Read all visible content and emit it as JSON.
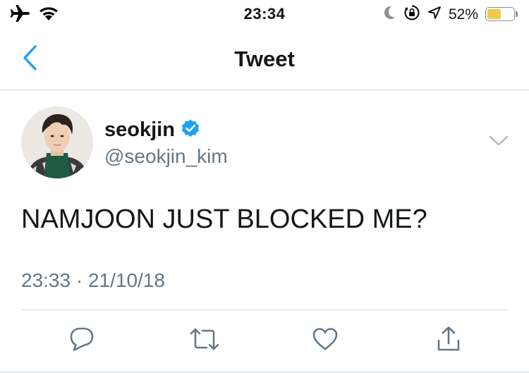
{
  "status_bar": {
    "time": "23:34",
    "battery_percent": "52%",
    "battery_level": 0.52,
    "battery_color": "#f2c94c",
    "icons": [
      "airplane-icon",
      "wifi-icon",
      "moon-icon",
      "rotation-lock-icon",
      "location-icon",
      "battery-icon"
    ]
  },
  "nav": {
    "title": "Tweet",
    "back_icon": "chevron-left-icon",
    "accent_color": "#1da1f2"
  },
  "tweet": {
    "display_name": "seokjin",
    "verified": true,
    "handle": "@seokjin_kim",
    "text": "NAMJOON JUST BLOCKED ME?",
    "timestamp": "23:33 · 21/10/18"
  },
  "actions": [
    "reply-icon",
    "retweet-icon",
    "like-icon",
    "share-icon"
  ],
  "colors": {
    "text_primary": "#14171a",
    "text_secondary": "#657786",
    "icon_gray": "#657786",
    "verified_blue": "#1da1f2"
  }
}
